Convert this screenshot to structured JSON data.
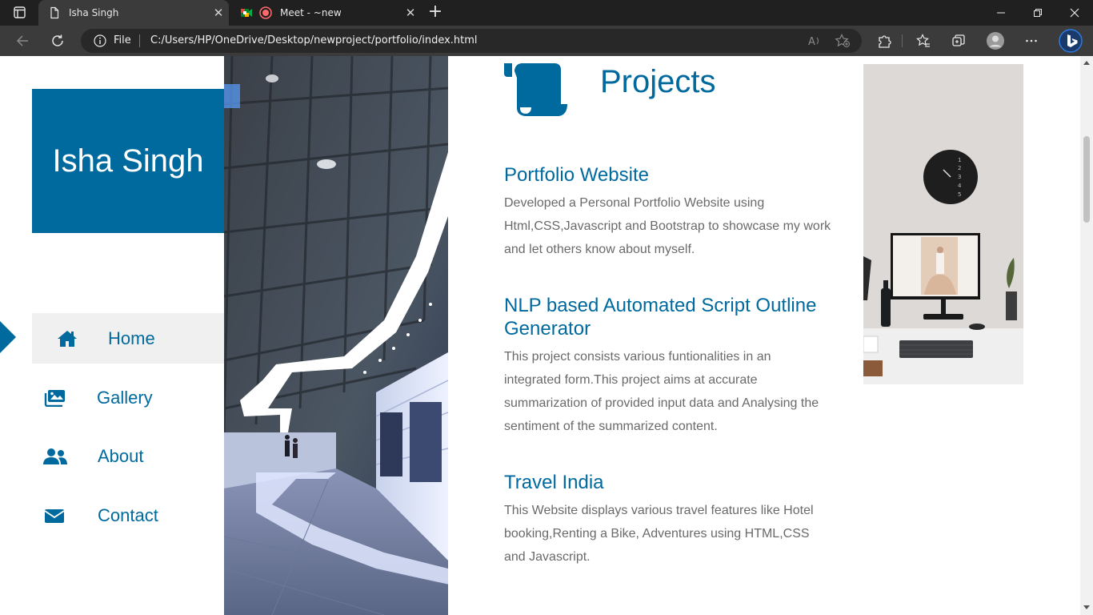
{
  "browser": {
    "tabs": [
      {
        "title": "Isha Singh",
        "active": true,
        "icon": "page-icon"
      },
      {
        "title": "Meet - ~new",
        "active": false,
        "icon": "meet-icon"
      }
    ],
    "address": {
      "scheme_label": "File",
      "url": "C:/Users/HP/OneDrive/Desktop/newproject/portfolio/index.html"
    }
  },
  "sidebar": {
    "name": "Isha Singh",
    "nav": [
      {
        "label": "Home",
        "icon": "home-icon",
        "active": true
      },
      {
        "label": "Gallery",
        "icon": "gallery-icon",
        "active": false
      },
      {
        "label": "About",
        "icon": "users-icon",
        "active": false
      },
      {
        "label": "Contact",
        "icon": "envelope-icon",
        "active": false
      }
    ]
  },
  "main": {
    "section_title": "Projects",
    "section_icon": "scroll-icon",
    "projects": [
      {
        "title": "Portfolio Website",
        "description": "Developed a Personal Portfolio Website using Html,CSS,Javascript and Bootstrap to showcase my work and let others know about myself."
      },
      {
        "title": "NLP based Automated Script Outline Generator",
        "description": "This project consists various funtionalities in an integrated form.This project aims at accurate summarization of provided input data and Analysing the sentiment of the summarized content."
      },
      {
        "title": "Travel India",
        "description": "This Website displays various travel features like Hotel booking,Renting a Bike, Adventures using HTML,CSS and Javascript."
      }
    ]
  },
  "colors": {
    "brand": "#006a9e",
    "nav_active_bg": "#f0f0f0",
    "body_text": "#6a6a6a"
  }
}
